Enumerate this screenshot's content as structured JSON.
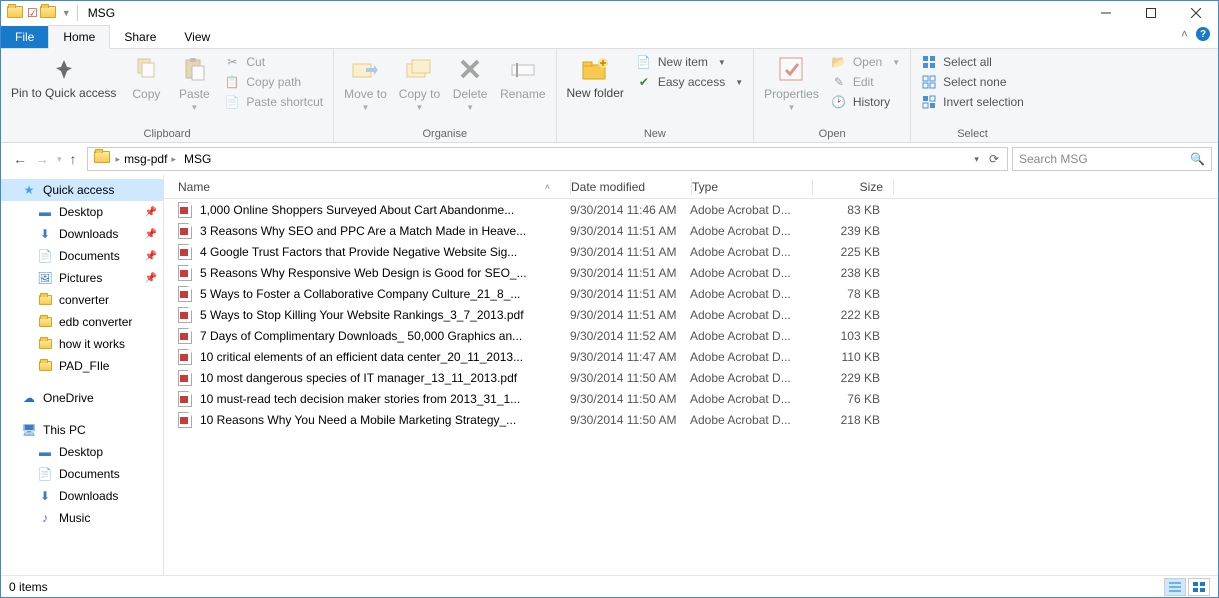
{
  "window": {
    "title": "MSG"
  },
  "tabs": {
    "file": "File",
    "home": "Home",
    "share": "Share",
    "view": "View"
  },
  "ribbon": {
    "clipboard": {
      "label": "Clipboard",
      "pin": "Pin to Quick access",
      "copy": "Copy",
      "paste": "Paste",
      "cut": "Cut",
      "copypath": "Copy path",
      "pasteshortcut": "Paste shortcut"
    },
    "organise": {
      "label": "Organise",
      "moveto": "Move to",
      "copyto": "Copy to",
      "delete": "Delete",
      "rename": "Rename"
    },
    "new": {
      "label": "New",
      "newfolder": "New folder",
      "newitem": "New item",
      "easyaccess": "Easy access"
    },
    "open": {
      "label": "Open",
      "properties": "Properties",
      "open": "Open",
      "edit": "Edit",
      "history": "History"
    },
    "select": {
      "label": "Select",
      "selectall": "Select all",
      "selectnone": "Select none",
      "invert": "Invert selection"
    }
  },
  "breadcrumb": {
    "parent": "msg-pdf",
    "current": "MSG"
  },
  "search": {
    "placeholder": "Search MSG"
  },
  "columns": {
    "name": "Name",
    "date": "Date modified",
    "type": "Type",
    "size": "Size"
  },
  "nav": {
    "quickaccess": "Quick access",
    "desktop": "Desktop",
    "downloads": "Downloads",
    "documents": "Documents",
    "pictures": "Pictures",
    "converter": "converter",
    "edbconverter": "edb converter",
    "howitworks": "how it works",
    "padfile": "PAD_FIle",
    "onedrive": "OneDrive",
    "thispc": "This PC",
    "desktop2": "Desktop",
    "documents2": "Documents",
    "downloads2": "Downloads",
    "music": "Music"
  },
  "files": [
    {
      "name": "1,000 Online Shoppers Surveyed About Cart Abandonme...",
      "date": "9/30/2014 11:46 AM",
      "type": "Adobe Acrobat D...",
      "size": "83 KB"
    },
    {
      "name": "3 Reasons Why SEO and PPC Are a Match Made in Heave...",
      "date": "9/30/2014 11:51 AM",
      "type": "Adobe Acrobat D...",
      "size": "239 KB"
    },
    {
      "name": "4 Google Trust Factors that Provide Negative Website Sig...",
      "date": "9/30/2014 11:51 AM",
      "type": "Adobe Acrobat D...",
      "size": "225 KB"
    },
    {
      "name": "5 Reasons Why Responsive Web Design is Good for SEO_...",
      "date": "9/30/2014 11:51 AM",
      "type": "Adobe Acrobat D...",
      "size": "238 KB"
    },
    {
      "name": "5 Ways to Foster a Collaborative Company Culture_21_8_...",
      "date": "9/30/2014 11:51 AM",
      "type": "Adobe Acrobat D...",
      "size": "78 KB"
    },
    {
      "name": "5 Ways to Stop Killing Your Website Rankings_3_7_2013.pdf",
      "date": "9/30/2014 11:51 AM",
      "type": "Adobe Acrobat D...",
      "size": "222 KB"
    },
    {
      "name": "7 Days of Complimentary Downloads_ 50,000 Graphics an...",
      "date": "9/30/2014 11:52 AM",
      "type": "Adobe Acrobat D...",
      "size": "103 KB"
    },
    {
      "name": "10 critical elements of an efficient data center_20_11_2013...",
      "date": "9/30/2014 11:47 AM",
      "type": "Adobe Acrobat D...",
      "size": "110 KB"
    },
    {
      "name": "10 most dangerous species of IT manager_13_11_2013.pdf",
      "date": "9/30/2014 11:50 AM",
      "type": "Adobe Acrobat D...",
      "size": "229 KB"
    },
    {
      "name": "10 must-read tech decision maker stories from 2013_31_1...",
      "date": "9/30/2014 11:50 AM",
      "type": "Adobe Acrobat D...",
      "size": "76 KB"
    },
    {
      "name": "10 Reasons Why You Need a Mobile Marketing Strategy_...",
      "date": "9/30/2014 11:50 AM",
      "type": "Adobe Acrobat D...",
      "size": "218 KB"
    }
  ],
  "status": {
    "items": "0 items"
  }
}
